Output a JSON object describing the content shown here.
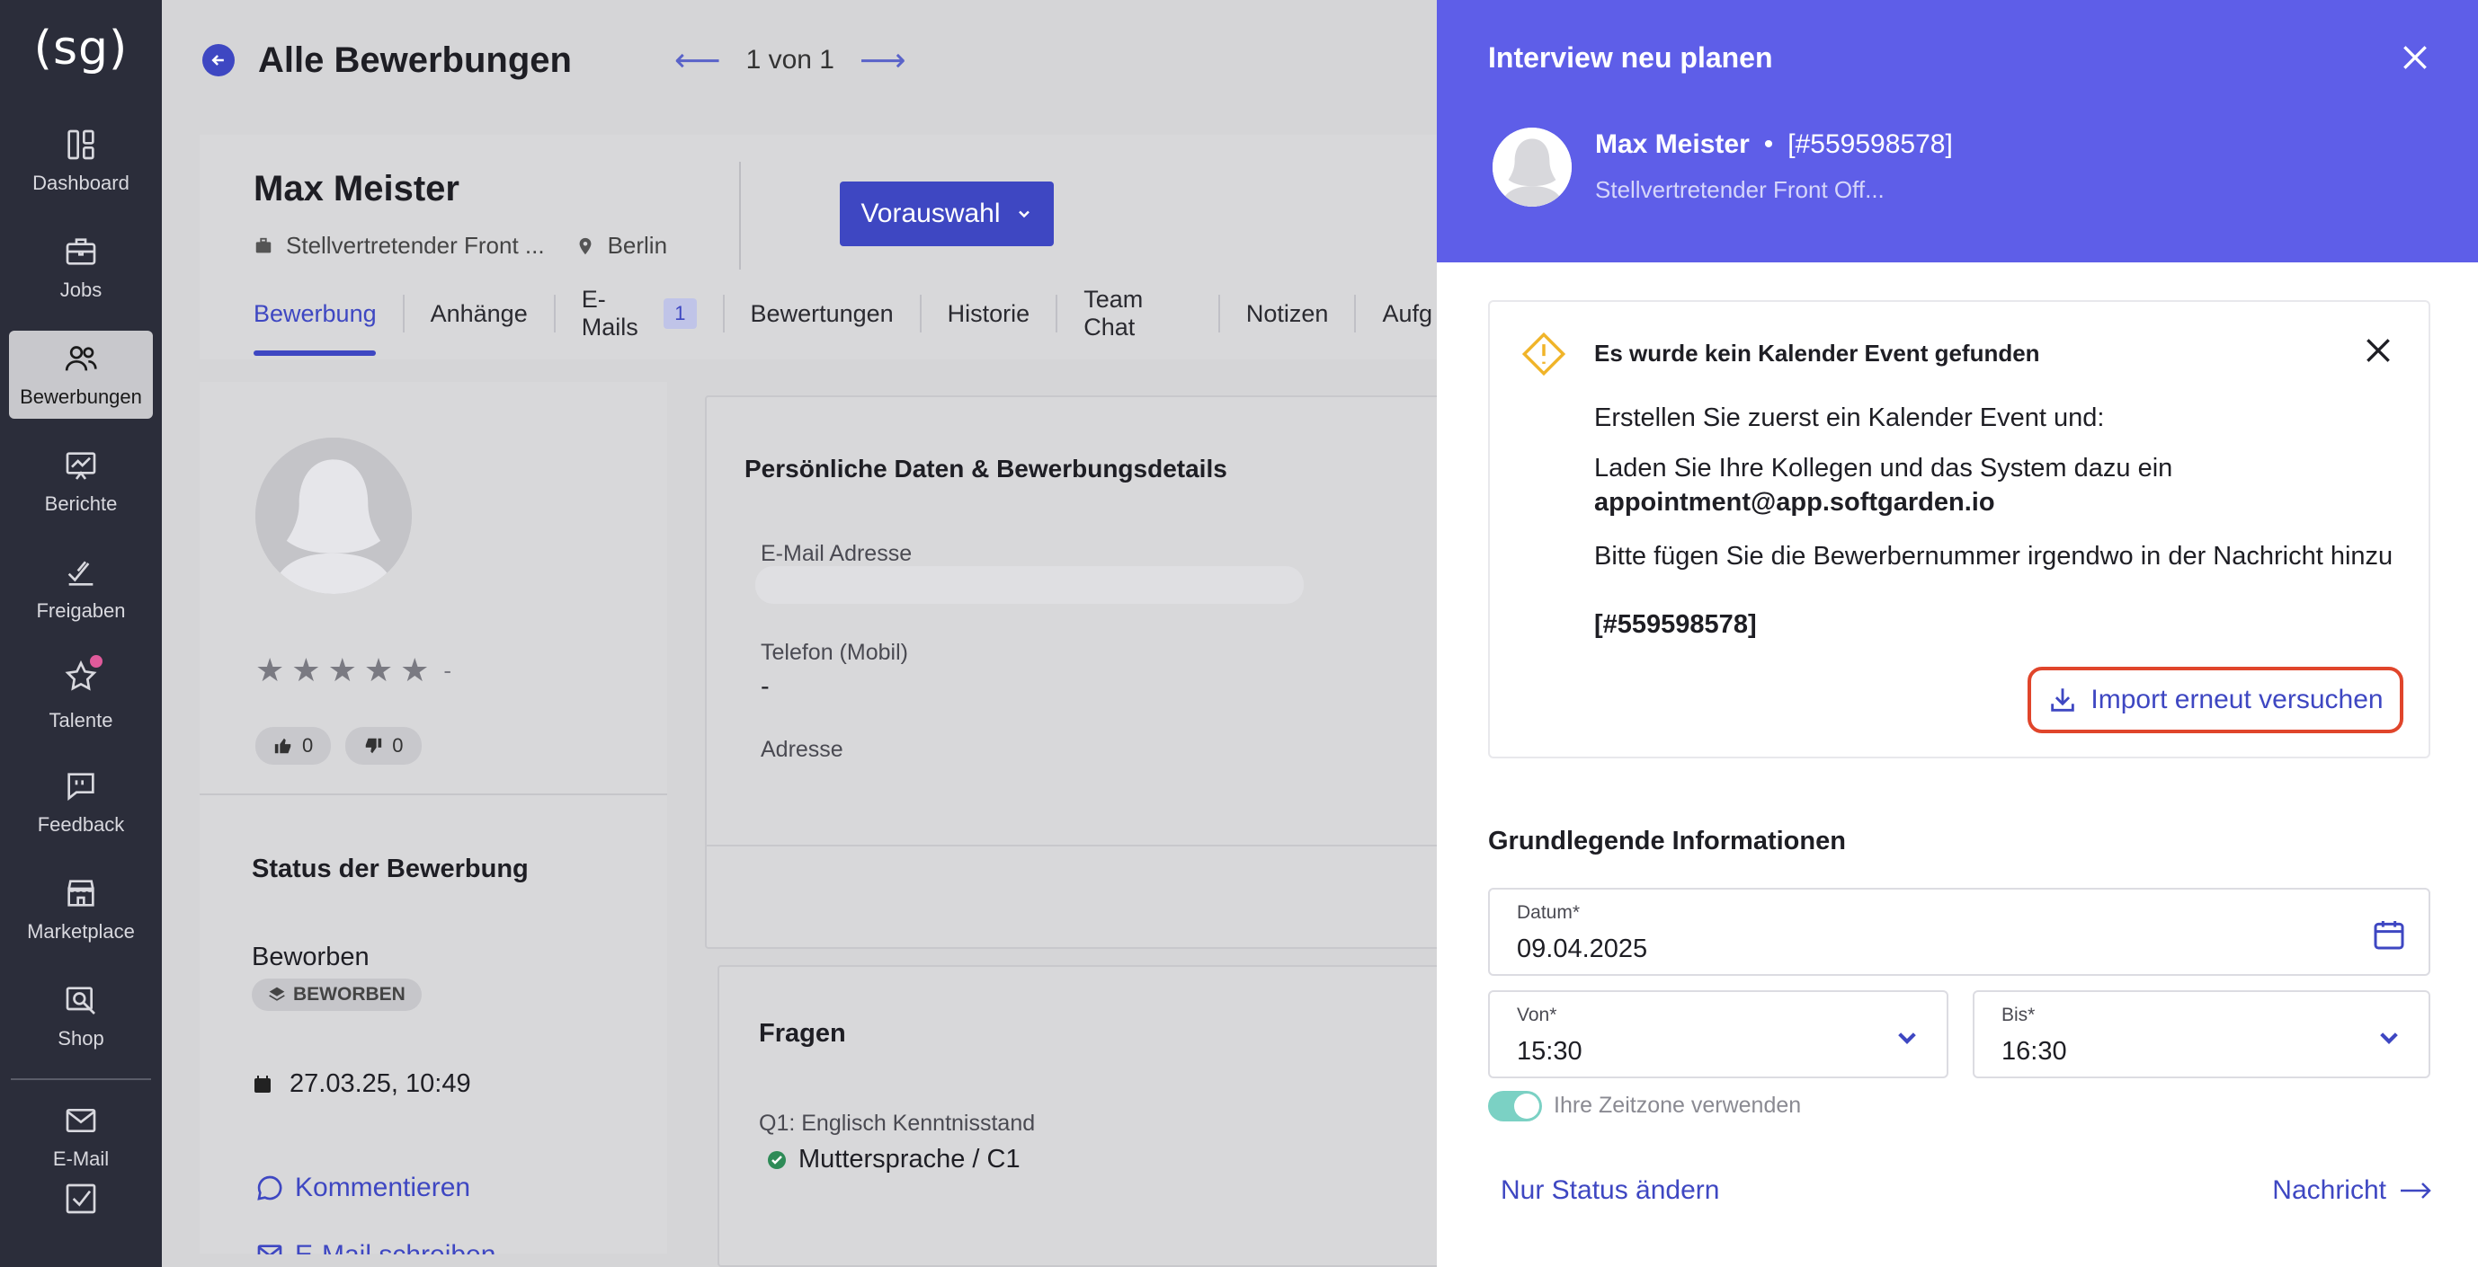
{
  "sidebar": {
    "logo": "(sg)",
    "items": [
      {
        "label": "Dashboard",
        "icon": "dashboard-icon"
      },
      {
        "label": "Jobs",
        "icon": "briefcase-icon"
      },
      {
        "label": "Bewerbungen",
        "icon": "users-icon"
      },
      {
        "label": "Berichte",
        "icon": "chart-icon"
      },
      {
        "label": "Freigaben",
        "icon": "approval-icon"
      },
      {
        "label": "Talente",
        "icon": "star-icon"
      },
      {
        "label": "Feedback",
        "icon": "feedback-icon"
      },
      {
        "label": "Marketplace",
        "icon": "store-icon"
      },
      {
        "label": "Shop",
        "icon": "shop-search-icon"
      },
      {
        "label": "E-Mail",
        "icon": "mail-icon"
      }
    ]
  },
  "header": {
    "title": "Alle Bewerbungen",
    "pager": "1 von 1"
  },
  "candidate": {
    "name": "Max Meister",
    "job": "Stellvertretender Front ...",
    "location": "Berlin",
    "status_button": "Vorauswahl",
    "tabs": [
      "Bewerbung",
      "Anhänge",
      "E-Mails",
      "Bewertungen",
      "Historie",
      "Team Chat",
      "Notizen",
      "Aufg"
    ],
    "email_badge": "1",
    "rating_dash": "-",
    "thumbs_up": "0",
    "thumbs_down": "0",
    "status_section_title": "Status der Bewerbung",
    "status_value": "Beworben",
    "status_chip": "BEWORBEN",
    "date": "27.03.25, 10:49",
    "comment_link": "Kommentieren",
    "email_link": "E-Mail schreiben"
  },
  "details": {
    "title": "Persönliche Daten & Bewerbungsdetails",
    "email_label": "E-Mail Adresse",
    "phone_label": "Telefon (Mobil)",
    "phone_value": "-",
    "address_label": "Adresse",
    "questions_title": "Fragen",
    "q1_label": "Q1: Englisch Kenntnisstand",
    "q1_value": "Muttersprache / C1"
  },
  "panel": {
    "title": "Interview neu planen",
    "name": "Max Meister",
    "applicant_id": "[#559598578]",
    "job": "Stellvertretender Front Off...",
    "alert": {
      "title": "Es wurde kein Kalender Event gefunden",
      "line1": "Erstellen Sie zuerst ein Kalender Event und:",
      "line2": "Laden Sie Ihre Kollegen und das System dazu ein",
      "email": "appointment@app.softgarden.io",
      "line3": "Bitte fügen Sie die Bewerbernummer irgendwo in der Nachricht hinzu",
      "id": "[#559598578]",
      "import_button": "Import erneut versuchen"
    },
    "section_title": "Grundlegende Informationen",
    "date_label": "Datum*",
    "date_value": "09.04.2025",
    "from_label": "Von*",
    "from_value": "15:30",
    "to_label": "Bis*",
    "to_value": "16:30",
    "timezone_label": "Ihre Zeitzone verwenden",
    "timezone_on": true,
    "status_only_link": "Nur Status ändern",
    "next_link": "Nachricht"
  },
  "colors": {
    "accent": "#3e47c2",
    "panel_header": "#5e5ee8",
    "highlight": "#e0452b",
    "warning": "#f0b429",
    "toggle": "#7bd1c4"
  }
}
